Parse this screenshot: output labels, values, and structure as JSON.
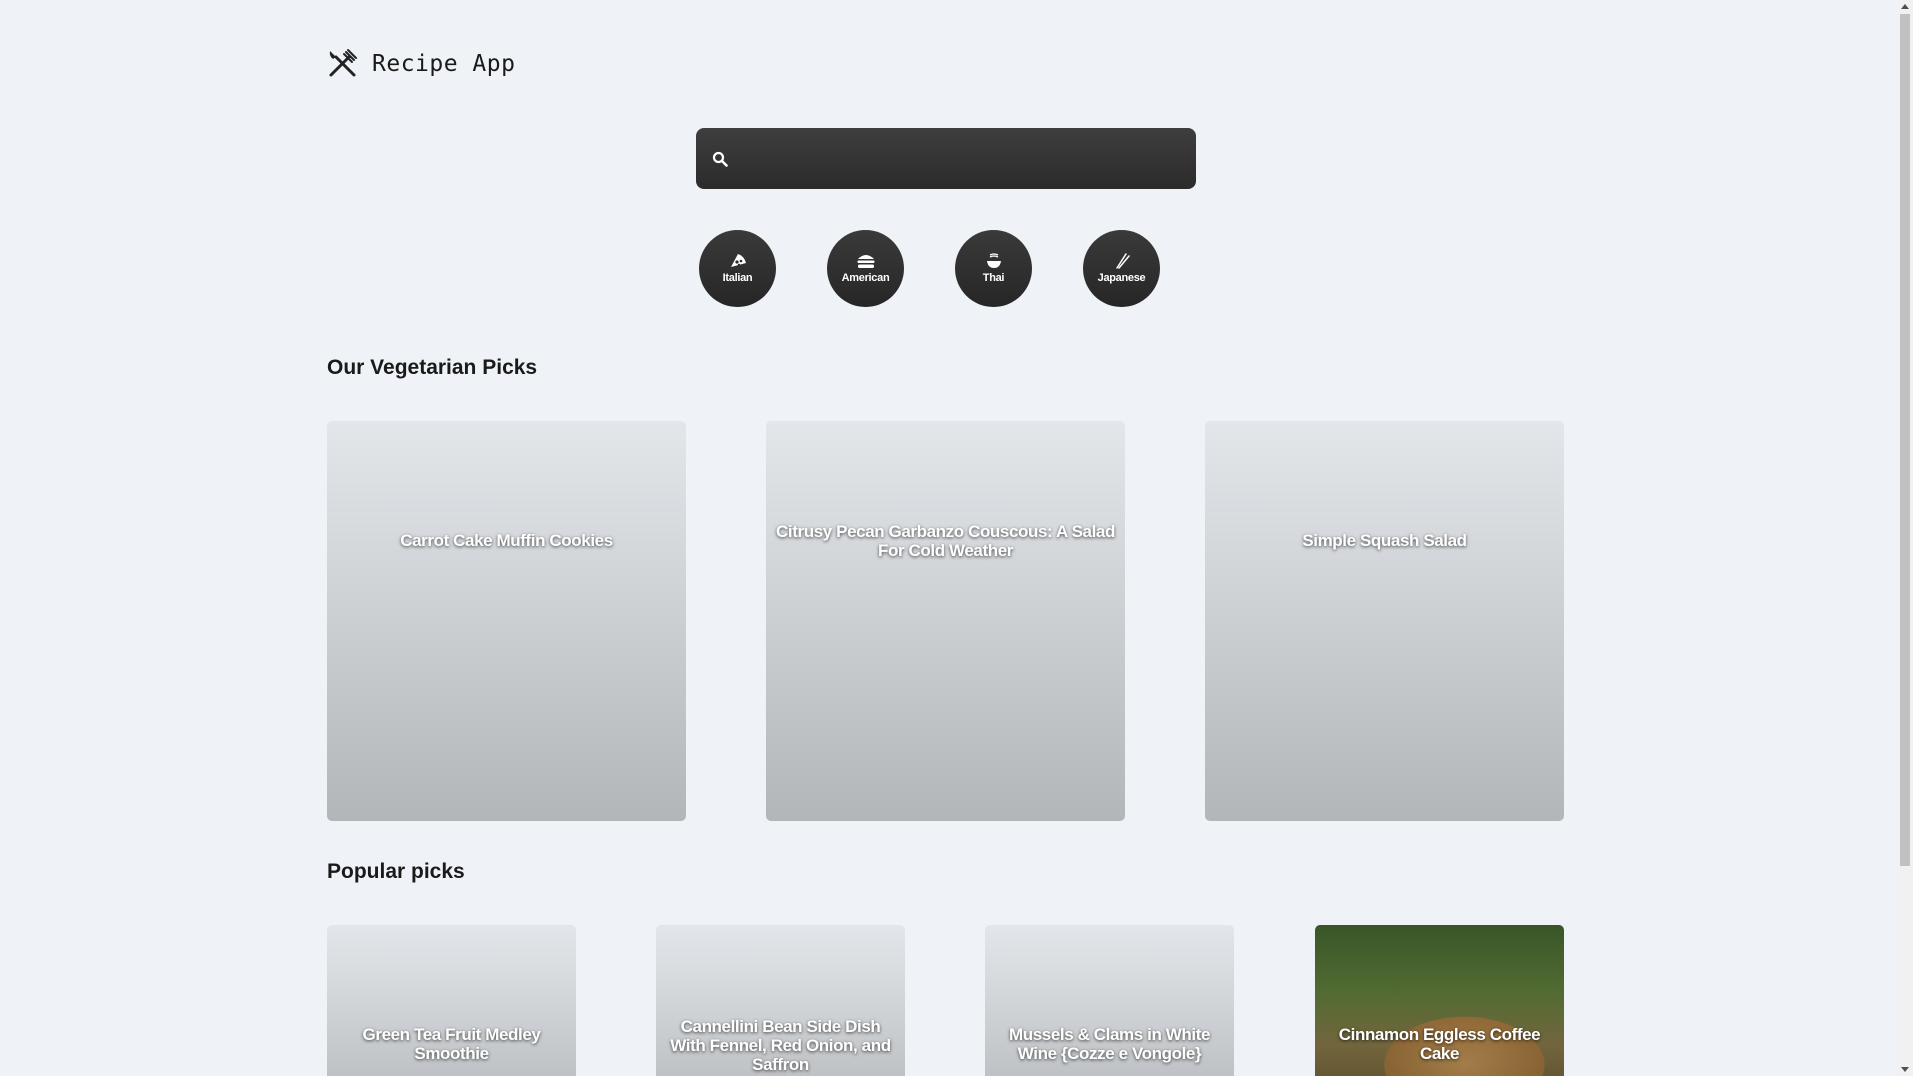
{
  "app": {
    "title": "Recipe App",
    "logo_icon": "fork-knife-icon"
  },
  "search": {
    "value": "",
    "placeholder": "",
    "icon": "search-icon"
  },
  "cuisines": [
    {
      "label": "Italian",
      "icon": "pizza-icon"
    },
    {
      "label": "American",
      "icon": "burger-icon"
    },
    {
      "label": "Thai",
      "icon": "noodle-bowl-icon"
    },
    {
      "label": "Japanese",
      "icon": "chopsticks-icon"
    }
  ],
  "vegetarian": {
    "title": "Our Vegetarian Picks",
    "items": [
      {
        "title": "Carrot Cake Muffin Cookies"
      },
      {
        "title": "Citrusy Pecan Garbanzo Couscous: A Salad For Cold Weather"
      },
      {
        "title": "Simple Squash Salad"
      }
    ]
  },
  "popular": {
    "title": "Popular picks",
    "items": [
      {
        "title": "Green Tea Fruit Medley Smoothie"
      },
      {
        "title": "Cannellini Bean Side Dish With Fennel, Red Onion, and Saffron"
      },
      {
        "title": "Mussels & Clams in White Wine {Cozze e Vongole}"
      },
      {
        "title": "Cinnamon Eggless Coffee Cake"
      }
    ]
  }
}
